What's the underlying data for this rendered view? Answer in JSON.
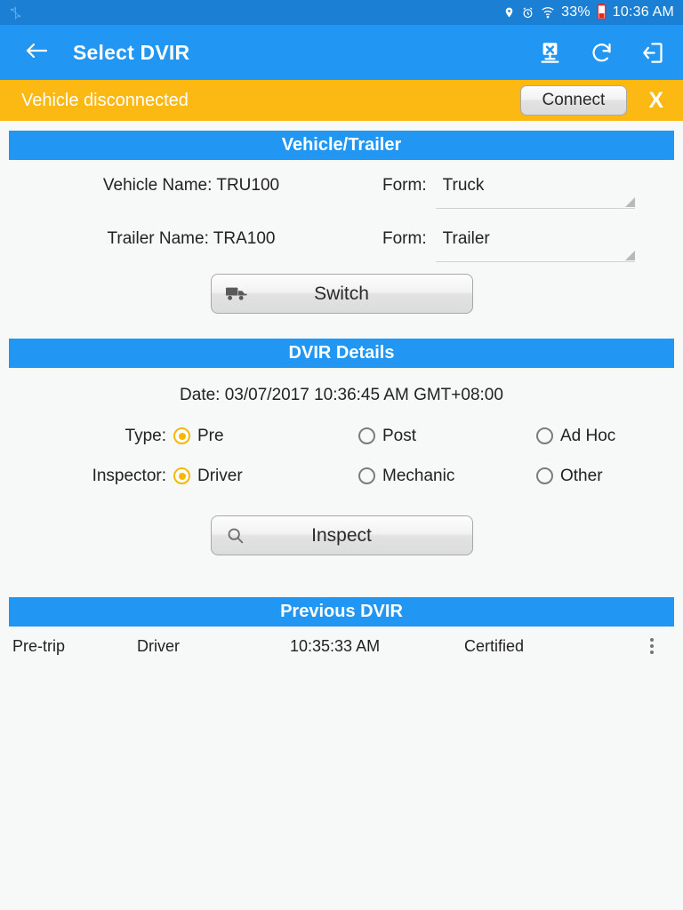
{
  "status_bar": {
    "app_icon": "bluetooth-share-icon",
    "icons": [
      "location-pin-icon",
      "alarm-clock-icon",
      "wifi-icon"
    ],
    "battery_percent": "33%",
    "battery_icon": "battery-low-icon",
    "time": "10:36 AM",
    "background": "#1b7fd4"
  },
  "app_bar": {
    "back_icon": "back-arrow-icon",
    "title": "Select DVIR",
    "background": "#2196f3",
    "actions": [
      {
        "name": "disconnect-device-icon",
        "label": "Disconnect"
      },
      {
        "name": "refresh-icon",
        "label": "Refresh"
      },
      {
        "name": "logout-icon",
        "label": "Logout"
      }
    ]
  },
  "banner": {
    "message": "Vehicle disconnected",
    "connect_label": "Connect",
    "close_label": "X",
    "background": "#fcb813"
  },
  "vehicle_trailer": {
    "header": "Vehicle/Trailer",
    "rows": [
      {
        "label": "Vehicle Name: TRU100",
        "form_label": "Form:",
        "form_value": "Truck"
      },
      {
        "label": "Trailer Name: TRA100",
        "form_label": "Form:",
        "form_value": "Trailer"
      }
    ],
    "switch_button": {
      "label": "Switch",
      "icon": "truck-icon"
    }
  },
  "dvir_details": {
    "header": "DVIR Details",
    "date": "Date: 03/07/2017 10:36:45 AM GMT+08:00",
    "type": {
      "label": "Type:",
      "options": [
        {
          "label": "Pre",
          "selected": true
        },
        {
          "label": "Post",
          "selected": false
        },
        {
          "label": "Ad Hoc",
          "selected": false
        }
      ]
    },
    "inspector": {
      "label": "Inspector:",
      "options": [
        {
          "label": "Driver",
          "selected": true
        },
        {
          "label": "Mechanic",
          "selected": false
        },
        {
          "label": "Other",
          "selected": false
        }
      ]
    },
    "inspect_button": {
      "label": "Inspect",
      "icon": "search-icon"
    }
  },
  "previous_dvir": {
    "header": "Previous DVIR",
    "rows": [
      {
        "type": "Pre-trip",
        "inspector": "Driver",
        "time": "10:35:33 AM",
        "status": "Certified",
        "menu_icon": "overflow-menu-icon"
      }
    ]
  },
  "colors": {
    "accent_blue": "#2196f3",
    "status_blue": "#1b7fd4",
    "warning_amber": "#fcb813",
    "radio_selected": "#f5b800",
    "page_background": "#f7f8f8"
  }
}
